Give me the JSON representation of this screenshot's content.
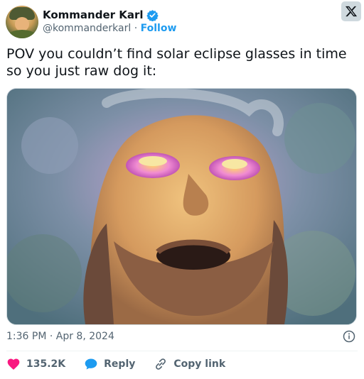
{
  "author": {
    "name": "Kommander Karl",
    "handle": "@kommanderkarl",
    "separator": " · ",
    "follow_label": "Follow"
  },
  "tweet": {
    "text": "POV you couldn’t find solar eclipse glasses in time\nso you just raw dog it:",
    "timestamp": "1:36 PM · Apr 8, 2024"
  },
  "actions": {
    "likes_count": "135.2K",
    "reply_label": "Reply",
    "copy_link_label": "Copy link"
  },
  "icons": {
    "verified": "verified-badge-icon",
    "x_logo": "x-logo-icon",
    "info": "info-icon",
    "heart": "heart-icon",
    "reply": "reply-bubble-icon",
    "link": "link-icon"
  },
  "colors": {
    "accent": "#1d9bf0",
    "like": "#f91880",
    "text": "#0f1419",
    "muted": "#536471"
  }
}
